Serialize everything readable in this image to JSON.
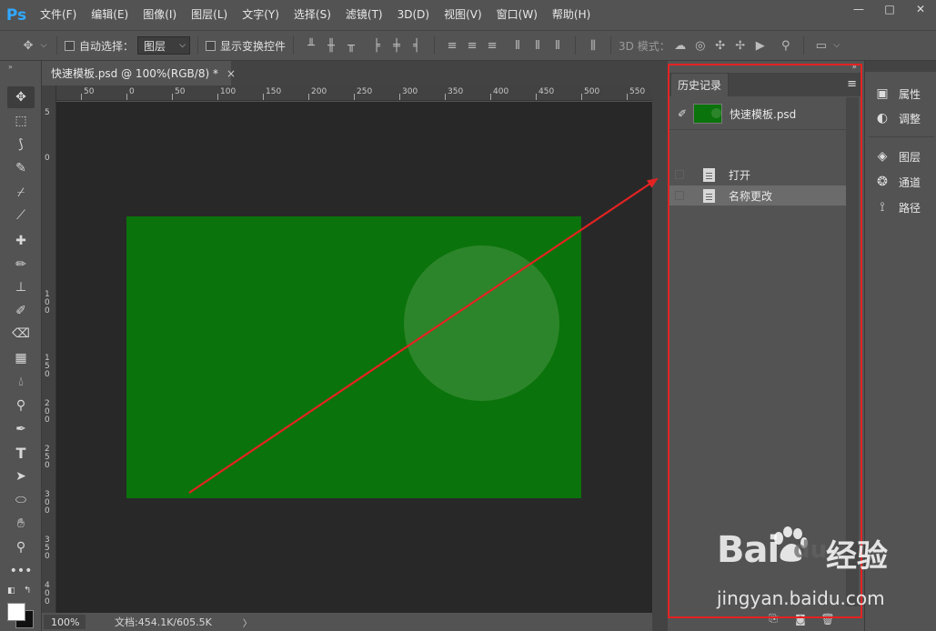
{
  "app": {
    "logo": "Ps"
  },
  "menu": [
    "文件(F)",
    "编辑(E)",
    "图像(I)",
    "图层(L)",
    "文字(Y)",
    "选择(S)",
    "滤镜(T)",
    "3D(D)",
    "视图(V)",
    "窗口(W)",
    "帮助(H)"
  ],
  "window_controls": {
    "minimize": "—",
    "restore": "□",
    "close": "✕"
  },
  "options": {
    "auto_select_label": "自动选择：",
    "auto_select_value": "图层",
    "show_transform_label": "显示变换控件",
    "mode_3d_label": "3D 模式："
  },
  "document": {
    "tab_title": "快速模板.psd @ 100%(RGB/8) *",
    "tab_close": "×",
    "zoom": "100%",
    "doc_info": "文档:454.1K/605.5K",
    "status_arrow": "〉"
  },
  "ruler_top": [
    "50",
    "0",
    "50",
    "100",
    "150",
    "200",
    "250",
    "300",
    "350",
    "400",
    "450",
    "500",
    "550"
  ],
  "ruler_left": [
    "5",
    "0",
    "1 0 0",
    "1 5 0",
    "2 0 0",
    "2 5 0",
    "3 0 0",
    "3 5 0",
    "4 0 0"
  ],
  "history": {
    "tab_label": "历史记录",
    "snapshot_label": "快速模板.psd",
    "states": [
      {
        "label": "打开",
        "selected": false
      },
      {
        "label": "名称更改",
        "selected": true
      }
    ]
  },
  "dock": {
    "items": [
      {
        "label": "属性",
        "icon": "properties-icon"
      },
      {
        "label": "调整",
        "icon": "adjustments-icon"
      },
      {
        "label": "图层",
        "icon": "layers-icon"
      },
      {
        "label": "通道",
        "icon": "channels-icon"
      },
      {
        "label": "路径",
        "icon": "paths-icon"
      }
    ]
  },
  "watermark": {
    "brand": "Bai",
    "brand_tail": "du",
    "cn": "经验",
    "url": "jingyan.baidu.com"
  },
  "colors": {
    "canvas_green": "#0b730b",
    "circle_green": "#2d852b",
    "highlight_red": "#e52222",
    "arrow_red": "#e52222"
  }
}
